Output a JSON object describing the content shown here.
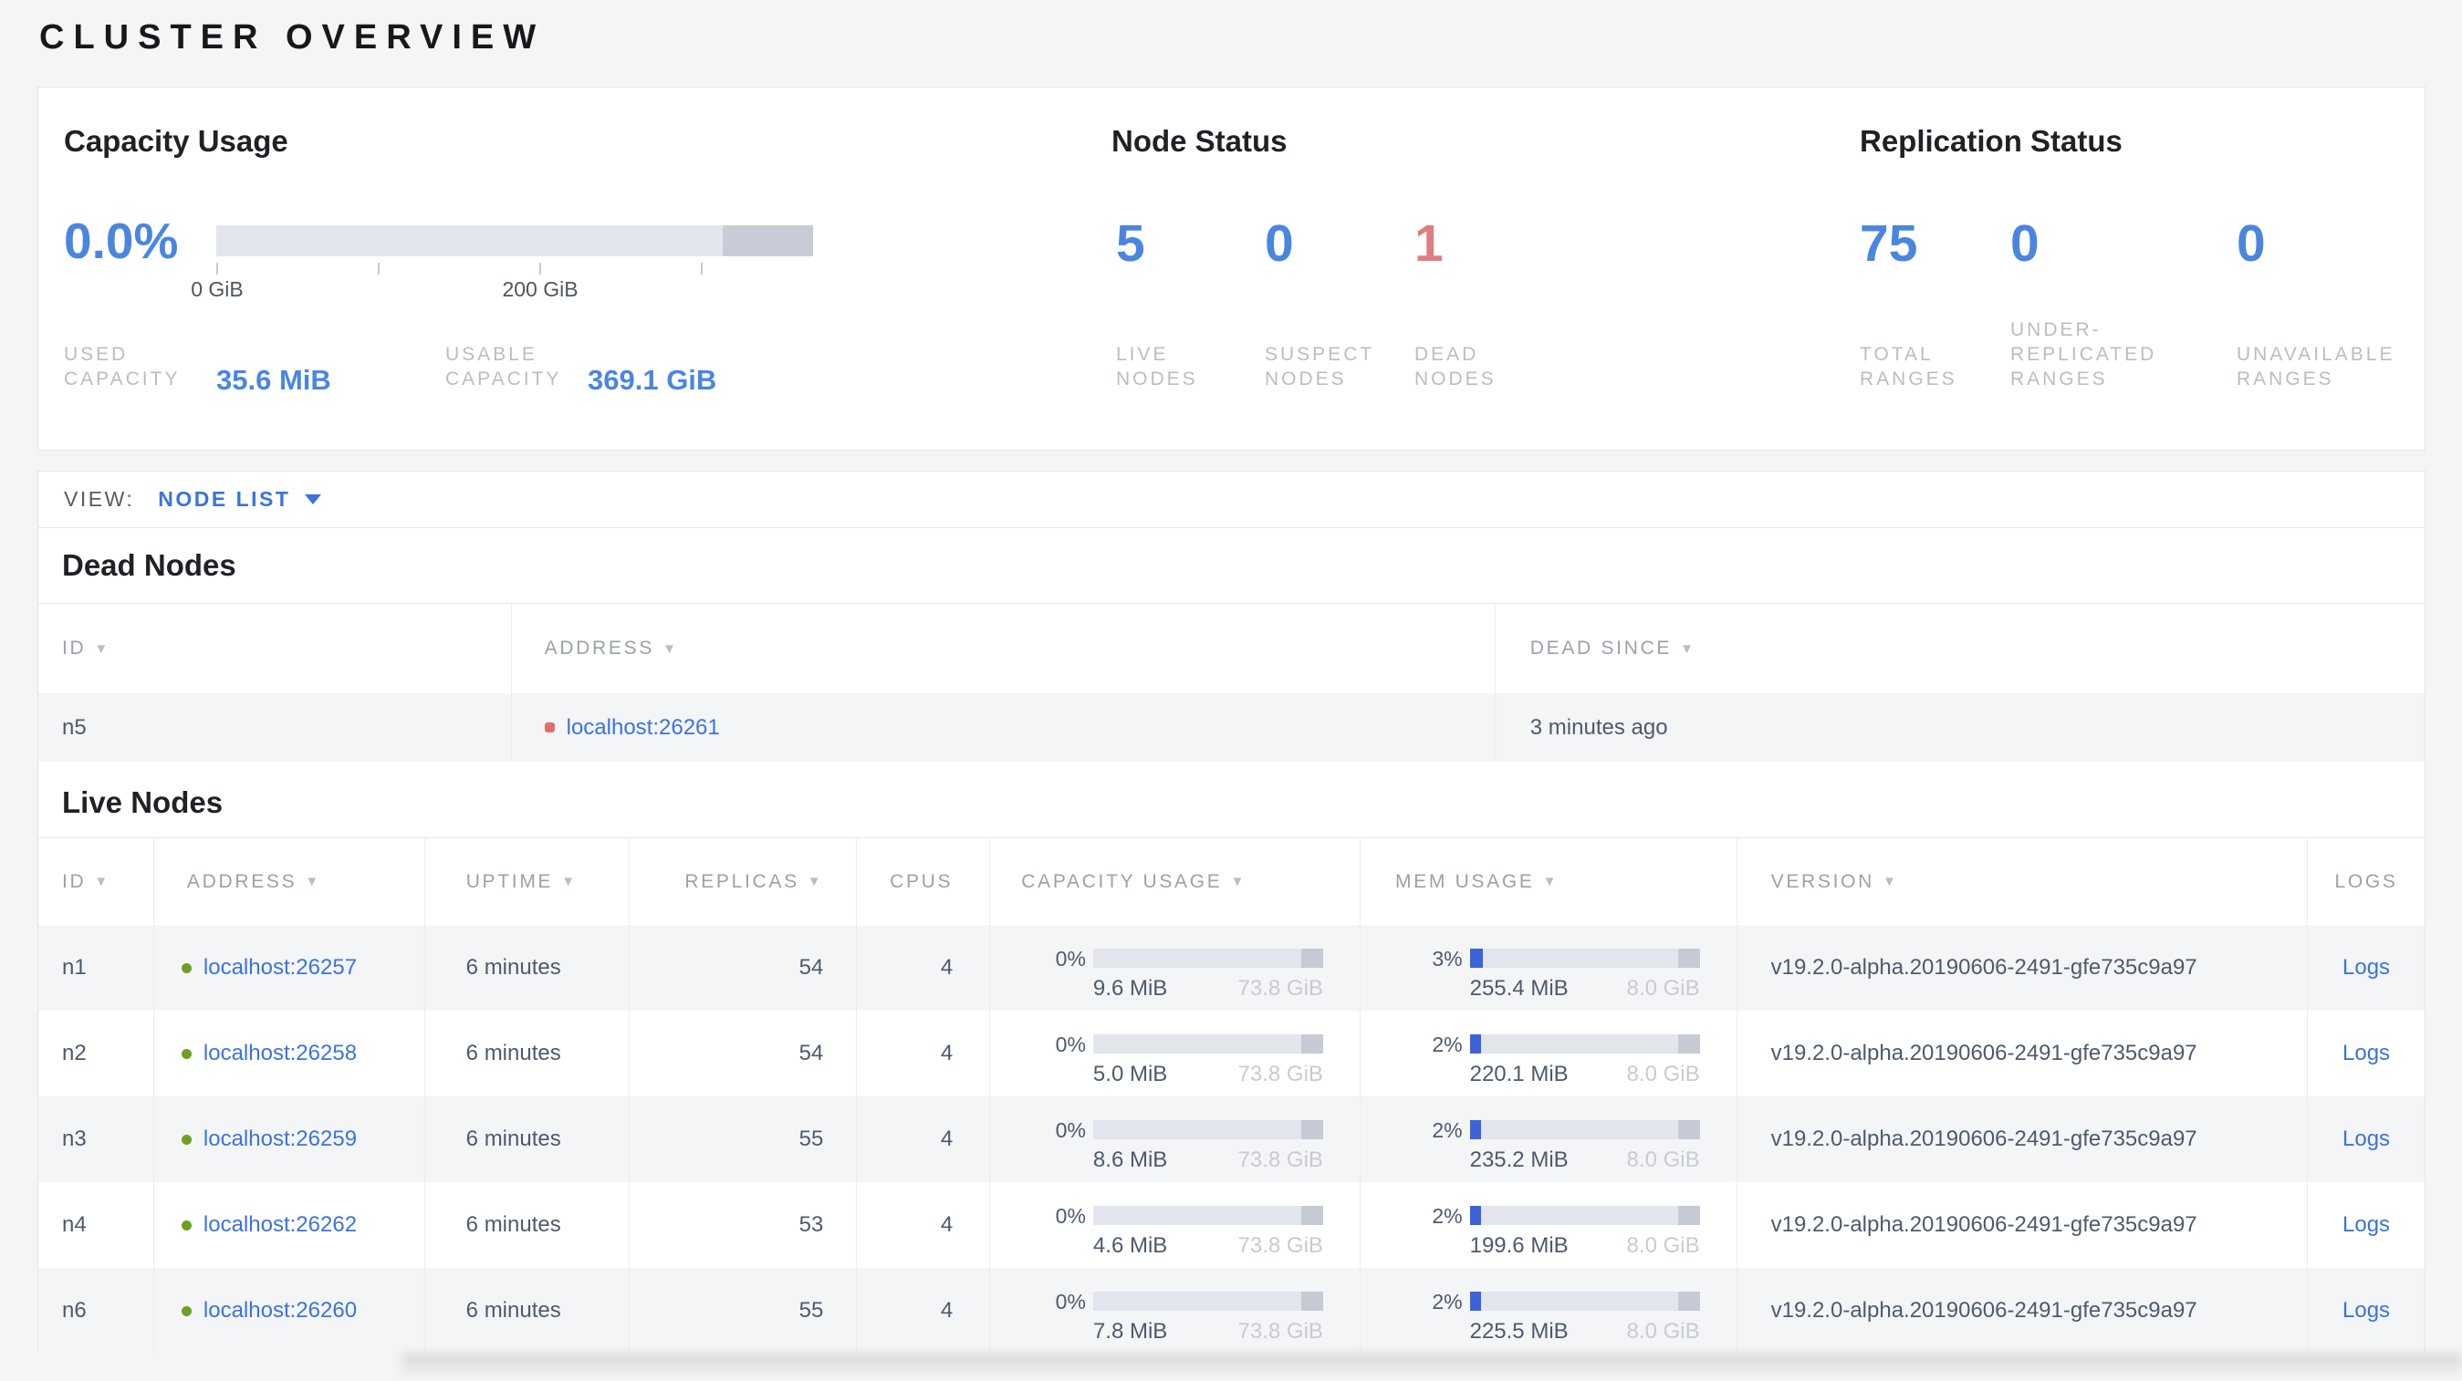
{
  "colors": {
    "accent_blue": "#4a86e0",
    "danger_red": "#de7e7e",
    "link_blue": "#3b73de",
    "live_green": "#6ca023",
    "dead_red": "#df716d",
    "bar_fill_blue": "#3d63d8",
    "bar_track": "#e2e5ec",
    "bar_end_segment": "#c6cad4"
  },
  "page": {
    "title": "CLUSTER OVERVIEW"
  },
  "summary": {
    "capacity": {
      "title": "Capacity Usage",
      "percent": "0.0%",
      "percent_value": 0,
      "tick_labels": [
        "0 GiB",
        "200 GiB"
      ],
      "used": {
        "label": "USED\nCAPACITY",
        "value": "35.6 MiB"
      },
      "usable": {
        "label": "USABLE\nCAPACITY",
        "value": "369.1 GiB"
      }
    },
    "node_status": {
      "title": "Node Status",
      "stats": [
        {
          "value": "5",
          "label": "LIVE\nNODES"
        },
        {
          "value": "0",
          "label": "SUSPECT\nNODES"
        },
        {
          "value": "1",
          "label": "DEAD\nNODES"
        }
      ]
    },
    "replication": {
      "title": "Replication Status",
      "stats": [
        {
          "value": "75",
          "label": "TOTAL\nRANGES"
        },
        {
          "value": "0",
          "label": "UNDER-\nREPLICATED\nRANGES"
        },
        {
          "value": "0",
          "label": "UNAVAILABLE\nRANGES"
        }
      ]
    }
  },
  "view_bar": {
    "label": "VIEW:",
    "selected": "NODE LIST"
  },
  "dead_nodes": {
    "heading": "Dead Nodes",
    "columns": [
      {
        "label": "ID"
      },
      {
        "label": "ADDRESS"
      },
      {
        "label": "DEAD SINCE"
      }
    ],
    "rows": [
      {
        "id": "n5",
        "address": "localhost:26261",
        "dead_since": "3 minutes ago"
      }
    ]
  },
  "live_nodes": {
    "heading": "Live Nodes",
    "logs_label": "Logs",
    "columns": [
      {
        "label": "ID"
      },
      {
        "label": "ADDRESS"
      },
      {
        "label": "UPTIME"
      },
      {
        "label": "REPLICAS"
      },
      {
        "label": "CPUS"
      },
      {
        "label": "CAPACITY USAGE"
      },
      {
        "label": "MEM USAGE"
      },
      {
        "label": "VERSION"
      },
      {
        "label": "LOGS"
      }
    ],
    "rows": [
      {
        "id": "n1",
        "address": "localhost:26257",
        "uptime": "6 minutes",
        "replicas": "54",
        "cpus": "4",
        "capacity": {
          "pct": "0%",
          "fill": 0,
          "used": "9.6 MiB",
          "total": "73.8 GiB"
        },
        "memory": {
          "pct": "3%",
          "fill": 3,
          "used": "255.4 MiB",
          "total": "8.0 GiB"
        },
        "version": "v19.2.0-alpha.20190606-2491-gfe735c9a97"
      },
      {
        "id": "n2",
        "address": "localhost:26258",
        "uptime": "6 minutes",
        "replicas": "54",
        "cpus": "4",
        "capacity": {
          "pct": "0%",
          "fill": 0,
          "used": "5.0 MiB",
          "total": "73.8 GiB"
        },
        "memory": {
          "pct": "2%",
          "fill": 2,
          "used": "220.1 MiB",
          "total": "8.0 GiB"
        },
        "version": "v19.2.0-alpha.20190606-2491-gfe735c9a97"
      },
      {
        "id": "n3",
        "address": "localhost:26259",
        "uptime": "6 minutes",
        "replicas": "55",
        "cpus": "4",
        "capacity": {
          "pct": "0%",
          "fill": 0,
          "used": "8.6 MiB",
          "total": "73.8 GiB"
        },
        "memory": {
          "pct": "2%",
          "fill": 2,
          "used": "235.2 MiB",
          "total": "8.0 GiB"
        },
        "version": "v19.2.0-alpha.20190606-2491-gfe735c9a97"
      },
      {
        "id": "n4",
        "address": "localhost:26262",
        "uptime": "6 minutes",
        "replicas": "53",
        "cpus": "4",
        "capacity": {
          "pct": "0%",
          "fill": 0,
          "used": "4.6 MiB",
          "total": "73.8 GiB"
        },
        "memory": {
          "pct": "2%",
          "fill": 2,
          "used": "199.6 MiB",
          "total": "8.0 GiB"
        },
        "version": "v19.2.0-alpha.20190606-2491-gfe735c9a97"
      },
      {
        "id": "n6",
        "address": "localhost:26260",
        "uptime": "6 minutes",
        "replicas": "55",
        "cpus": "4",
        "capacity": {
          "pct": "0%",
          "fill": 0,
          "used": "7.8 MiB",
          "total": "73.8 GiB"
        },
        "memory": {
          "pct": "2%",
          "fill": 2,
          "used": "225.5 MiB",
          "total": "8.0 GiB"
        },
        "version": "v19.2.0-alpha.20190606-2491-gfe735c9a97"
      }
    ]
  }
}
